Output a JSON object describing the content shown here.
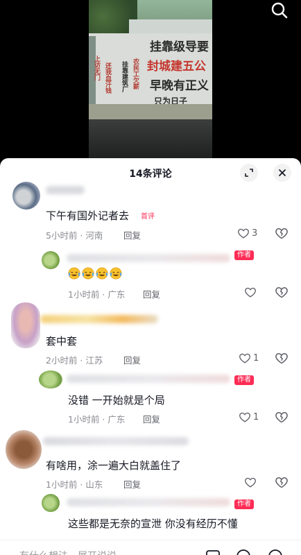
{
  "video": {
    "sign_line1": "挂靠级导要",
    "sign_line2": "封城建五公",
    "sign_line3": "早晚有正义",
    "sign_line4": "只为日子",
    "side_text1": "上访无门",
    "side_text2": "还我血汗钱",
    "side_text3": "挂靠建筑厂",
    "side_text4": "农民工欠薪"
  },
  "header": {
    "title": "14条评论"
  },
  "comments": [
    {
      "text": "下午有国外记者去",
      "tag": "首评",
      "time": "5小时前",
      "location": "河南",
      "reply": "回复",
      "likes": "3",
      "replies": [
        {
          "tag": "作者",
          "time": "1小时前",
          "location": "广东",
          "reply": "回复",
          "emoji_count": 4
        }
      ]
    },
    {
      "text": "套中套",
      "time": "2小时前",
      "location": "江苏",
      "reply": "回复",
      "likes": "1",
      "replies": [
        {
          "tag": "作者",
          "text": "没错 一开始就是个局",
          "time": "1小时前",
          "location": "广东",
          "reply": "回复",
          "likes": "1"
        }
      ]
    },
    {
      "text": "有啥用，涂一遍大白就盖住了",
      "time": "1小时前",
      "location": "山东",
      "reply": "回复",
      "replies": [
        {
          "tag": "作者",
          "text": "这些都是无奈的宣泄 你没有经历不懂"
        }
      ]
    }
  ],
  "input": {
    "placeholder": "有什么想法，展开说说"
  },
  "colors": {
    "accent": "#fe2c55",
    "meta": "#8a8b91"
  }
}
